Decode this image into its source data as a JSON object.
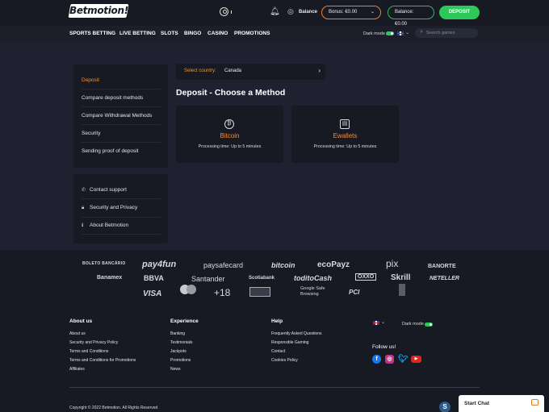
{
  "header": {
    "logo": "Betmotion!",
    "balance_label": "Balance",
    "bonus_pill": "Bonus: €0.00",
    "balance_pill": "Balance: €0.00",
    "deposit_button": "DEPOSIT"
  },
  "nav": {
    "items": [
      "SPORTS BETTING",
      "LIVE BETTING",
      "SLOTS",
      "BINGO",
      "CASINO",
      "PROMOTIONS"
    ],
    "dark_mode_label": "Dark mode",
    "search_placeholder": "Search games"
  },
  "sidebar": {
    "primary": [
      "Deposit",
      "Compare deposit methods",
      "Compare Withdrawal Methods",
      "Security",
      "Sending proof of deposit"
    ],
    "secondary": [
      {
        "label": "Contact support",
        "icon": "phone-icon"
      },
      {
        "label": "Security and Privacy",
        "icon": "lock-icon"
      },
      {
        "label": "About Betmotion",
        "icon": "info-icon"
      }
    ]
  },
  "main": {
    "country_label": "Select country:",
    "country_value": "Canada",
    "heading": "Deposit - Choose a Method",
    "methods": [
      {
        "name": "Bitcoin",
        "time": "Processing time: Up to 5 minutes",
        "icon": "bitcoin-icon"
      },
      {
        "name": "Ewallets",
        "time": "Processing time: Up to 5 minutes",
        "icon": "wallet-icon"
      }
    ]
  },
  "payment_logos": {
    "row1": [
      "BOLETO BANCÁRIO",
      "pay4fun",
      "paysafecard",
      "bitcoin",
      "ecoPayz",
      "pix",
      "BANORTE"
    ],
    "row2": [
      "Banamex",
      "BBVA",
      "Santander",
      "Scotiabank",
      "toditoCash",
      "OXXO",
      "Skrill",
      "NETELLER"
    ],
    "row3": [
      "VISA",
      "+18",
      "Google Safe Browsing",
      "PCI"
    ]
  },
  "footer": {
    "about_title": "About us",
    "about_links": [
      "About us",
      "Security and Privacy Policy",
      "Terms and Conditions",
      "Terms and Conditions for Promotions",
      "Affiliates"
    ],
    "experience_title": "Experience",
    "experience_links": [
      "Banking",
      "Testimonials",
      "Jackpots",
      "Promotions",
      "News"
    ],
    "help_title": "Help",
    "help_links": [
      "Frequently Asked Questions",
      "Responsible Gaming",
      "Contact",
      "Cookies Policy"
    ],
    "dark_mode_label": "Dark mode",
    "follow_us": "Follow us!",
    "copyright": "Copyright © 2022 Betmotion. All Rights Reserved",
    "chat_label": "Start Chat"
  },
  "colors": {
    "accent_orange": "#f0913a",
    "accent_green": "#2ec85a",
    "background": "#1f2130",
    "panel": "#171923"
  }
}
